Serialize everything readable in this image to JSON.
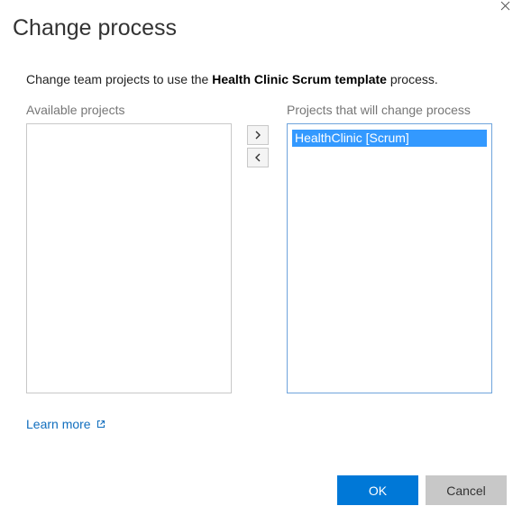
{
  "dialog": {
    "title": "Change process",
    "close_icon": "close-icon"
  },
  "description": {
    "prefix": "Change team projects to use the ",
    "process_name": "Health Clinic Scrum template",
    "suffix": " process."
  },
  "available": {
    "label": "Available projects",
    "items": []
  },
  "target": {
    "label": "Projects that will change process",
    "items": [
      "HealthClinic [Scrum]"
    ]
  },
  "move_buttons": {
    "right_icon": "chevron-right-icon",
    "left_icon": "chevron-left-icon"
  },
  "learn_more": {
    "label": "Learn more",
    "icon": "external-link-icon"
  },
  "buttons": {
    "ok": "OK",
    "cancel": "Cancel"
  },
  "colors": {
    "primary": "#0078d7",
    "selection": "#3399ff",
    "link": "#106ebe"
  }
}
